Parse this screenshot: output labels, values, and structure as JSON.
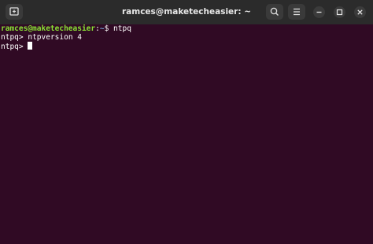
{
  "window": {
    "title": "ramces@maketecheasier: ~",
    "icons": {
      "new_tab": "new-tab-icon",
      "search": "search-icon",
      "menu": "hamburger-menu-icon",
      "minimize": "minimize-icon",
      "maximize": "maximize-icon",
      "close": "close-icon"
    }
  },
  "terminal": {
    "line1": {
      "user_host": "ramces@maketecheasier",
      "separator": ":",
      "path": "~",
      "symbol": "$",
      "command": "ntpq"
    },
    "line2": {
      "prompt": "ntpq>",
      "command": "ntpversion 4"
    },
    "line3": {
      "prompt": "ntpq>"
    }
  },
  "colors": {
    "background": "#300a24",
    "titlebar": "#2b2b2b",
    "prompt_user": "#8ae234",
    "prompt_path": "#729fcf",
    "text": "#ffffff"
  }
}
